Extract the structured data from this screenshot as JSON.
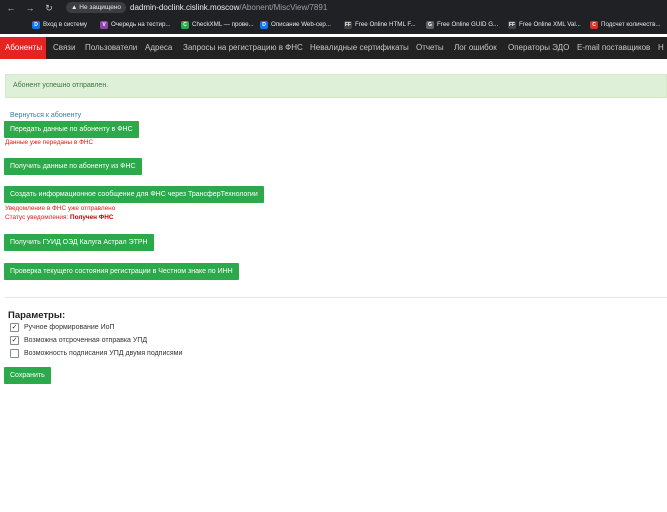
{
  "browser": {
    "security_badge": "Не защищено",
    "url_host": "dadmin-doclink.cislink.moscow",
    "url_path": "/Abonent/MiscView/7891",
    "bookmarks": [
      {
        "label": "Вход в систему",
        "icon": "D",
        "color": "#1a73e8"
      },
      {
        "label": "Очередь на тестир...",
        "icon": "V",
        "color": "#8e44ad"
      },
      {
        "label": "CheckXML — прове...",
        "icon": "C",
        "color": "#2ca94a"
      },
      {
        "label": "Описание Web-сер...",
        "icon": "D",
        "color": "#1a73e8"
      },
      {
        "label": "Free Online HTML F...",
        "icon": "FF",
        "color": "#444444"
      },
      {
        "label": "Free Online GUID G...",
        "icon": "G",
        "color": "#5f6368"
      },
      {
        "label": "Free Online XML Val...",
        "icon": "FF",
        "color": "#444444"
      },
      {
        "label": "Подсчет количеств...",
        "icon": "C",
        "color": "#d93025"
      }
    ]
  },
  "nav": {
    "items": [
      "Абоненты",
      "Связи",
      "Пользователи",
      "Адреса",
      "Запросы на регистрацию в ФНС",
      "Невалидные сертификаты",
      "Отчеты",
      "Лог ошибок",
      "Операторы ЭДО",
      "E-mail поставщиков",
      "Н"
    ]
  },
  "alert_text": "Абонент успешно отправлен.",
  "back_link": "Вернуться к абоненту",
  "buttons": {
    "send_fns": "Передать данные по абоненту в ФНС",
    "get_fns": "Получить данные по абоненту из ФНС",
    "create_msg": "Создать информационное сообщение для ФНС через ТрансферТехнологии",
    "get_guid": "Получить ГУИД ОЭД Калуга Астрал ЭТРН",
    "check_state": "Проверка текущего состояния регистрации в Честном знаке по ИНН",
    "save": "Сохранить"
  },
  "notes": {
    "data_sent": "Данные уже переданы в ФНС",
    "notice_sent": "Уведомление в ФНС уже отправлено",
    "status_label": "Статус уведомления:",
    "status_value": "Получен ФНС"
  },
  "params": {
    "title": "Параметры:",
    "options": [
      {
        "label": "Ручное формирование ИоП",
        "checked": true
      },
      {
        "label": "Возможна отсроченная отправка УПД",
        "checked": true
      },
      {
        "label": "Возможность подписания УПД двумя подписями",
        "checked": false
      }
    ]
  }
}
